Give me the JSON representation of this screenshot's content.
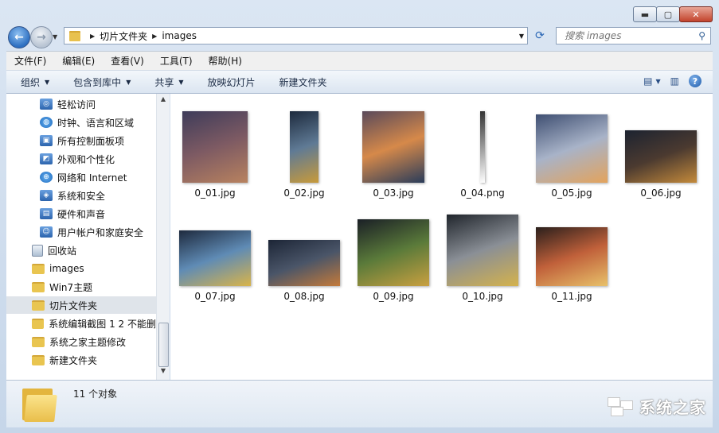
{
  "window": {
    "caption_buttons": {
      "minimize": "▬",
      "maximize": "▢",
      "close": "✕"
    }
  },
  "address": {
    "crumbs": [
      "切片文件夹",
      "images"
    ],
    "search_placeholder": "搜索 images"
  },
  "menu": [
    "文件(F)",
    "编辑(E)",
    "查看(V)",
    "工具(T)",
    "帮助(H)"
  ],
  "commands": [
    "组织",
    "包含到库中",
    "共享",
    "放映幻灯片",
    "新建文件夹"
  ],
  "nav": [
    {
      "label": "轻松访问",
      "icon": "ease-of-access-icon"
    },
    {
      "label": "时钟、语言和区域",
      "icon": "clock-globe-icon"
    },
    {
      "label": "所有控制面板项",
      "icon": "control-panel-icon"
    },
    {
      "label": "外观和个性化",
      "icon": "appearance-icon"
    },
    {
      "label": "网络和 Internet",
      "icon": "network-icon"
    },
    {
      "label": "系统和安全",
      "icon": "security-icon"
    },
    {
      "label": "硬件和声音",
      "icon": "hardware-icon"
    },
    {
      "label": "用户帐户和家庭安全",
      "icon": "users-icon"
    },
    {
      "label": "回收站",
      "icon": "recycle-bin-icon"
    },
    {
      "label": "images",
      "icon": "folder-icon"
    },
    {
      "label": "Win7主题",
      "icon": "folder-icon"
    },
    {
      "label": "切片文件夹",
      "icon": "folder-icon",
      "selected": true
    },
    {
      "label": "系统编辑截图 1 2  不能删",
      "icon": "folder-icon"
    },
    {
      "label": "系统之家主题修改",
      "icon": "folder-icon"
    },
    {
      "label": "新建文件夹",
      "icon": "folder-icon"
    }
  ],
  "files": [
    {
      "name": "0_01.jpg",
      "colors": [
        "#3e3c5a",
        "#7d5a63",
        "#b8825f"
      ]
    },
    {
      "name": "0_02.jpg",
      "colors": [
        "#1d2a3d",
        "#5f7a95",
        "#c89a3a"
      ]
    },
    {
      "name": "0_03.jpg",
      "colors": [
        "#5a4a5a",
        "#d6894a",
        "#2a3c5a"
      ]
    },
    {
      "name": "0_04.png",
      "colors": [
        "#333333",
        "#999999",
        "#ffffff"
      ]
    },
    {
      "name": "0_05.jpg",
      "colors": [
        "#3f4f72",
        "#a8b3c8",
        "#e3a35c"
      ]
    },
    {
      "name": "0_06.jpg",
      "colors": [
        "#1c2330",
        "#4b3a30",
        "#c48a3b"
      ]
    },
    {
      "name": "0_07.jpg",
      "colors": [
        "#1e2a3e",
        "#5f8bb5",
        "#d9b44a"
      ]
    },
    {
      "name": "0_08.jpg",
      "colors": [
        "#1c2536",
        "#4a5568",
        "#c47a3a"
      ]
    },
    {
      "name": "0_09.jpg",
      "colors": [
        "#1a1f26",
        "#5a7a3a",
        "#c9a040"
      ]
    },
    {
      "name": "0_10.jpg",
      "colors": [
        "#20252c",
        "#8a8f96",
        "#d4b24c"
      ]
    },
    {
      "name": "0_11.jpg",
      "colors": [
        "#2a1f1c",
        "#c0603a",
        "#e8c16a"
      ]
    }
  ],
  "details": {
    "count": "11 个对象"
  },
  "watermark": "系统之家"
}
